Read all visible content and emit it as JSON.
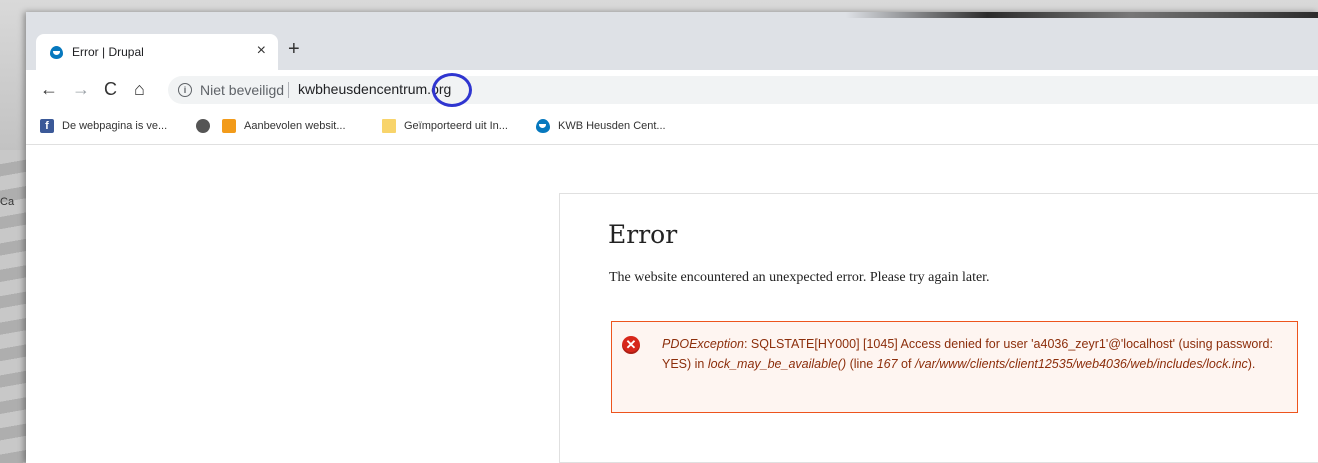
{
  "backdrop": {
    "label": "Ca"
  },
  "tab": {
    "title": "Error | Drupal",
    "close": "×",
    "new_tab": "+"
  },
  "toolbar": {
    "back": "←",
    "forward": "→",
    "reload": "C",
    "home": "⌂",
    "security_label": "Niet beveiligd",
    "url": "kwbheusdencentrum.org"
  },
  "bookmarks": [
    {
      "label": "De webpagina is ve...",
      "icon": "facebook-icon"
    },
    {
      "label": "",
      "icon": "globe-icon"
    },
    {
      "label": "Aanbevolen websit...",
      "icon": "lightbulb-icon"
    },
    {
      "label": "Geïmporteerd uit In...",
      "icon": "folder-icon"
    },
    {
      "label": "KWB Heusden Cent...",
      "icon": "drupal-icon"
    }
  ],
  "page": {
    "title": "Error",
    "description": "The website encountered an unexpected error. Please try again later.",
    "error": {
      "exception": "PDOException",
      "part1": ": SQLSTATE[HY000] [1045] Access denied for user 'a4036_zeyr1'@'localhost' (using password: YES) in ",
      "function": "lock_may_be_available()",
      "part2": " (line ",
      "line": "167",
      "part3": " of ",
      "file": "/var/www/clients/client12535/web4036/web/includes/lock.inc",
      "part4": ")."
    }
  },
  "colors": {
    "error_border": "#ed541d",
    "error_bg": "#fef5f1",
    "error_text": "#8c2e0b",
    "annotation_circle": "#2f35d0"
  }
}
